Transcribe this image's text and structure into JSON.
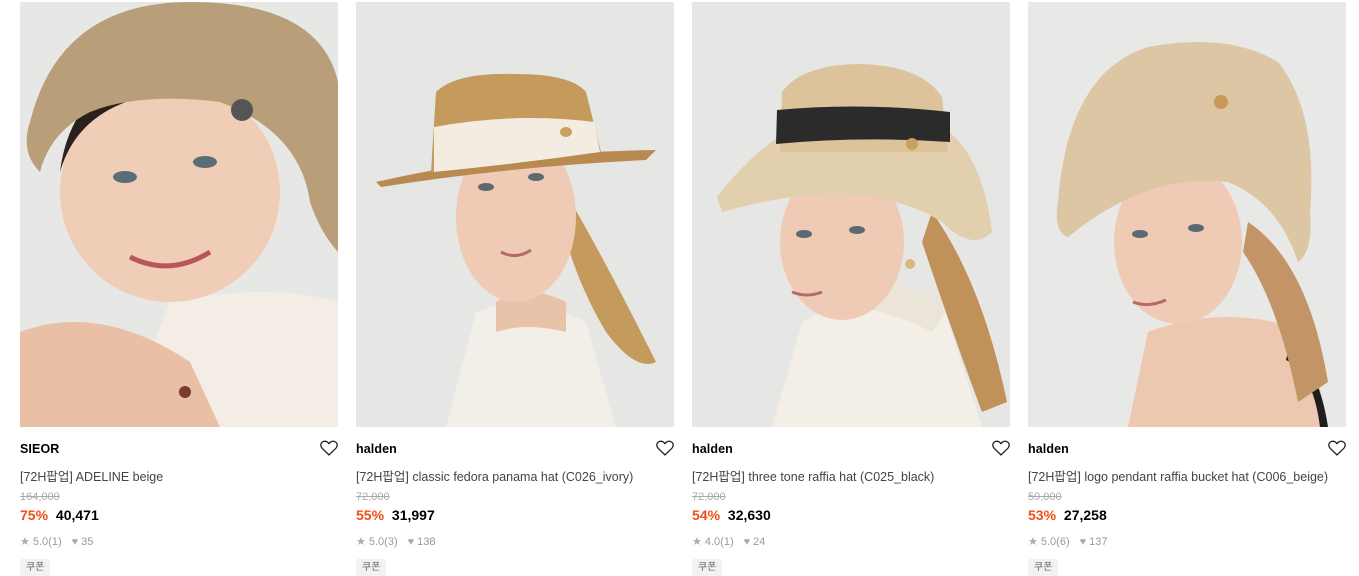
{
  "products": [
    {
      "brand": "SIEOR",
      "title": "[72H팝업] ADELINE beige",
      "original_price": "164,000",
      "discount": "75%",
      "price": "40,471",
      "rating": "5.0",
      "reviews": "(1)",
      "likes": "35",
      "badge": "쿠폰",
      "hat_color": "#b99e7a",
      "bg_color": "#e7e7e5"
    },
    {
      "brand": "halden",
      "title": "[72H팝업] classic fedora panama hat (C026_ivory)",
      "original_price": "72,000",
      "discount": "55%",
      "price": "31,997",
      "rating": "5.0",
      "reviews": "(3)",
      "likes": "138",
      "badge": "쿠폰",
      "hat_color": "#c59a5d",
      "bg_color": "#e6e6e4"
    },
    {
      "brand": "halden",
      "title": "[72H팝업] three tone raffia hat (C025_black)",
      "original_price": "72,000",
      "discount": "54%",
      "price": "32,630",
      "rating": "4.0",
      "reviews": "(1)",
      "likes": "24",
      "badge": "쿠폰",
      "hat_color": "#e2cfae",
      "bg_color": "#e6e6e4"
    },
    {
      "brand": "halden",
      "title": "[72H팝업] logo pendant raffia bucket hat (C006_beige)",
      "original_price": "59,000",
      "discount": "53%",
      "price": "27,258",
      "rating": "5.0",
      "reviews": "(6)",
      "likes": "137",
      "badge": "쿠폰",
      "hat_color": "#dcc6a3",
      "bg_color": "#e8e8e6"
    }
  ],
  "icons": {
    "wishlist": "heart-outline-icon",
    "rating": "star-icon",
    "likes": "heart-filled-icon"
  },
  "colors": {
    "discount": "#f24e16",
    "muted": "#999999"
  }
}
